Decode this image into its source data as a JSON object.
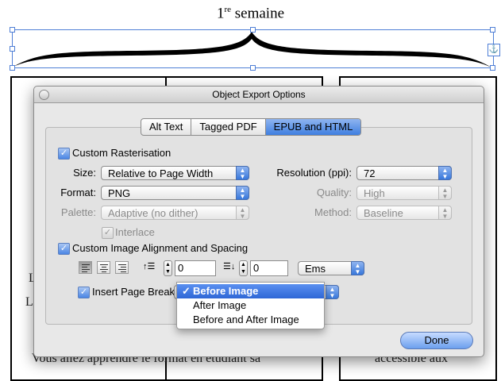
{
  "document": {
    "heading_main": "1",
    "heading_sup": "re",
    "heading_rest": " semaine",
    "bg_left_1": "L",
    "bg_left_2": "L",
    "bg_bottom_left": "Vous allez apprendre le format en étudiant sa",
    "bg_bottom_right": "accessible aux"
  },
  "dialog": {
    "title": "Object Export Options",
    "tabs": [
      {
        "label": "Alt Text",
        "selected": false
      },
      {
        "label": "Tagged PDF",
        "selected": false
      },
      {
        "label": "EPUB and HTML",
        "selected": true
      }
    ],
    "custom_rasterisation": {
      "label": "Custom Rasterisation",
      "checked": true
    },
    "size": {
      "label": "Size:",
      "value": "Relative to Page Width"
    },
    "format": {
      "label": "Format:",
      "value": "PNG"
    },
    "palette": {
      "label": "Palette:",
      "value": "Adaptive (no dither)"
    },
    "interlace": {
      "label": "Interlace",
      "checked": true
    },
    "resolution": {
      "label": "Resolution (ppi):",
      "value": "72"
    },
    "quality": {
      "label": "Quality:",
      "value": "High"
    },
    "method": {
      "label": "Method:",
      "value": "Baseline"
    },
    "custom_alignment": {
      "label": "Custom Image Alignment and Spacing",
      "checked": true
    },
    "space_before": "0",
    "space_after": "0",
    "units": "Ems",
    "insert_page_break": {
      "label": "Insert Page Break",
      "checked": true
    },
    "page_break_menu": [
      "Before Image",
      "After Image",
      "Before and After Image"
    ],
    "page_break_selected": "Before Image",
    "checkmark": "✓",
    "done_label": "Done"
  },
  "colors": {
    "accent": "#3f7fe0",
    "selection": "#2e67d6",
    "frame": "#4f7fd6"
  }
}
